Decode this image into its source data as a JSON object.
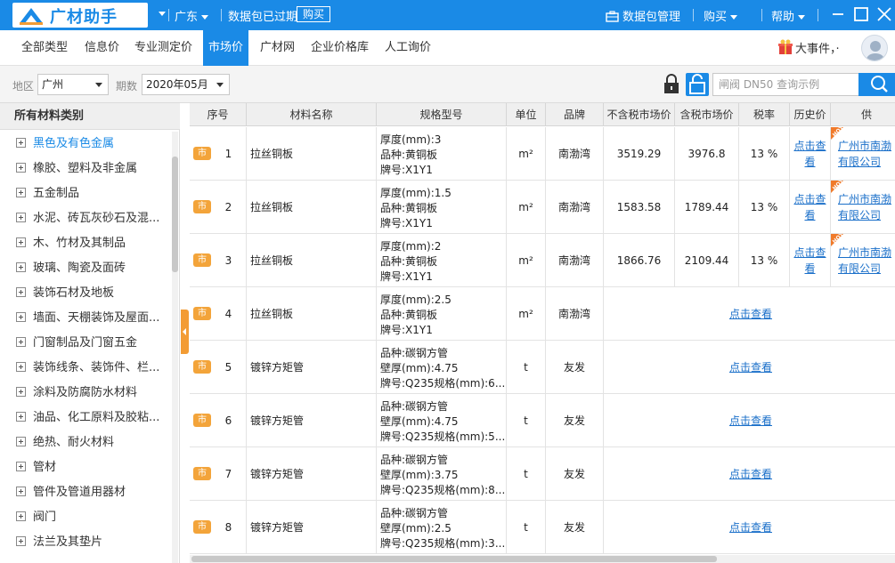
{
  "app": {
    "name": "广材助手",
    "region": "广东",
    "data_status": "数据包已过期",
    "buy_button": "购买",
    "data_manage": "数据包管理",
    "menu_buy": "购买",
    "menu_help": "帮助",
    "brand_color": "#1a8ae6"
  },
  "nav": {
    "tabs": [
      {
        "label": "全部类型",
        "active": false
      },
      {
        "label": "信息价",
        "active": false
      },
      {
        "label": "专业测定价",
        "active": false
      },
      {
        "label": "市场价",
        "active": true
      },
      {
        "label": "广材网",
        "active": false
      },
      {
        "label": "企业价格库",
        "active": false
      },
      {
        "label": "人工询价",
        "active": false
      }
    ],
    "news": "大事件，·"
  },
  "filter": {
    "region_label": "地区",
    "region_value": "广州",
    "period_label": "期数",
    "period_value": "2020年05月",
    "search_placeholder": "闸阀 DN50 查询示例"
  },
  "sidebar": {
    "title": "所有材料类别",
    "items": [
      {
        "label": "黑色及有色金属",
        "active": true
      },
      {
        "label": "橡胶、塑料及非金属",
        "active": false
      },
      {
        "label": "五金制品",
        "active": false
      },
      {
        "label": "水泥、砖瓦灰砂石及混...",
        "active": false
      },
      {
        "label": "木、竹材及其制品",
        "active": false
      },
      {
        "label": "玻璃、陶瓷及面砖",
        "active": false
      },
      {
        "label": "装饰石材及地板",
        "active": false
      },
      {
        "label": "墙面、天棚装饰及屋面...",
        "active": false
      },
      {
        "label": "门窗制品及门窗五金",
        "active": false
      },
      {
        "label": "装饰线条、装饰件、栏...",
        "active": false
      },
      {
        "label": "涂料及防腐防水材料",
        "active": false
      },
      {
        "label": "油品、化工原料及胶粘...",
        "active": false
      },
      {
        "label": "绝热、耐火材料",
        "active": false
      },
      {
        "label": "管材",
        "active": false
      },
      {
        "label": "管件及管道用器材",
        "active": false
      },
      {
        "label": "阀门",
        "active": false
      },
      {
        "label": "法兰及其垫片",
        "active": false
      }
    ]
  },
  "table": {
    "headers": [
      "序号",
      "材料名称",
      "规格型号",
      "单位",
      "品牌",
      "不含税市场价",
      "含税市场价",
      "税率",
      "历史价",
      "供"
    ],
    "badge": "市",
    "hot": "HOT",
    "rows": [
      {
        "no": "1",
        "name": "拉丝铜板",
        "spec1": "厚度(mm):3",
        "spec2": "品种:黄铜板",
        "spec3": "牌号:X1Y1",
        "unit": "m²",
        "brand": "南渤湾",
        "price_ex": "3519.29",
        "price_in": "3976.8",
        "tax": "13 %",
        "history1": "点击查",
        "history2": "看",
        "supplier1": "广州市南渤",
        "supplier2": "有限公司"
      },
      {
        "no": "2",
        "name": "拉丝铜板",
        "spec1": "厚度(mm):1.5",
        "spec2": "品种:黄铜板",
        "spec3": "牌号:X1Y1",
        "unit": "m²",
        "brand": "南渤湾",
        "price_ex": "1583.58",
        "price_in": "1789.44",
        "tax": "13 %",
        "history1": "点击查",
        "history2": "看",
        "supplier1": "广州市南渤",
        "supplier2": "有限公司"
      },
      {
        "no": "3",
        "name": "拉丝铜板",
        "spec1": "厚度(mm):2",
        "spec2": "品种:黄铜板",
        "spec3": "牌号:X1Y1",
        "unit": "m²",
        "brand": "南渤湾",
        "price_ex": "1866.76",
        "price_in": "2109.44",
        "tax": "13 %",
        "history1": "点击查",
        "history2": "看",
        "supplier1": "广州市南渤",
        "supplier2": "有限公司"
      },
      {
        "no": "4",
        "name": "拉丝铜板",
        "spec1": "厚度(mm):2.5",
        "spec2": "品种:黄铜板",
        "spec3": "牌号:X1Y1",
        "unit": "m²",
        "brand": "南渤湾",
        "view": "点击查看"
      },
      {
        "no": "5",
        "name": "镀锌方矩管",
        "spec1": "品种:碳钢方管",
        "spec2": "壁厚(mm):4.75",
        "spec3": "牌号:Q235规格(mm):6...",
        "unit": "t",
        "brand": "友发",
        "view": "点击查看"
      },
      {
        "no": "6",
        "name": "镀锌方矩管",
        "spec1": "品种:碳钢方管",
        "spec2": "壁厚(mm):4.75",
        "spec3": "牌号:Q235规格(mm):5...",
        "unit": "t",
        "brand": "友发",
        "view": "点击查看"
      },
      {
        "no": "7",
        "name": "镀锌方矩管",
        "spec1": "品种:碳钢方管",
        "spec2": "壁厚(mm):3.75",
        "spec3": "牌号:Q235规格(mm):8...",
        "unit": "t",
        "brand": "友发",
        "view": "点击查看"
      },
      {
        "no": "8",
        "name": "镀锌方矩管",
        "spec1": "品种:碳钢方管",
        "spec2": "壁厚(mm):2.5",
        "spec3": "牌号:Q235规格(mm):3...",
        "unit": "t",
        "brand": "友发",
        "view": "点击查看"
      }
    ]
  }
}
